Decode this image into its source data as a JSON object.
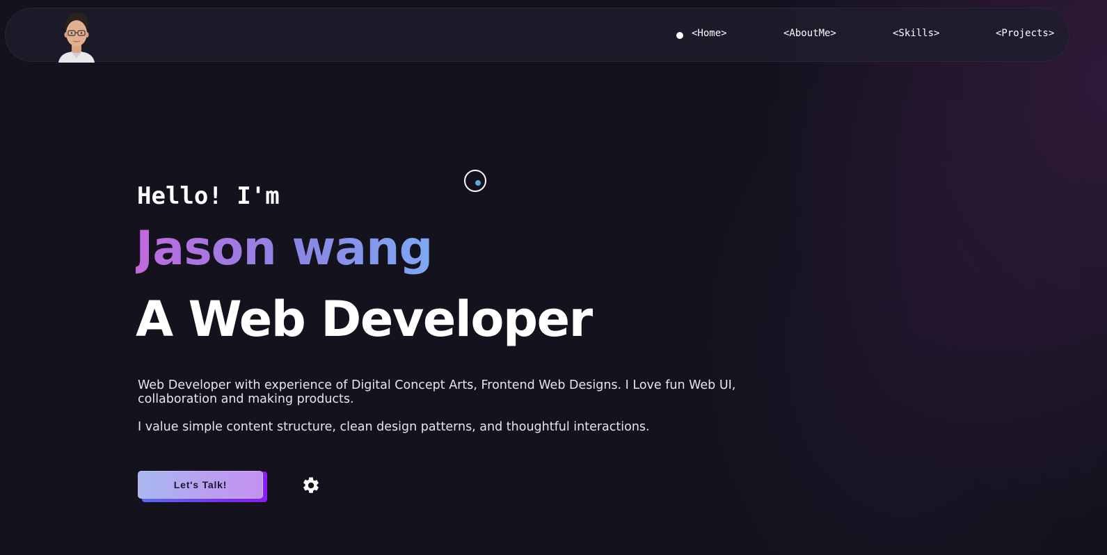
{
  "nav": {
    "items": [
      {
        "label": "<Home>",
        "active": true
      },
      {
        "label": "<AboutMe>",
        "active": false
      },
      {
        "label": "<Skills>",
        "active": false
      },
      {
        "label": "<Projects>",
        "active": false
      }
    ],
    "avatar_icon": "person-avatar"
  },
  "hero": {
    "greeting": "Hello! I'm",
    "name": "Jason wang",
    "role": "A Web Developer",
    "description_1": "Web Developer with experience of Digital Concept Arts, Frontend Web Designs. I Love fun Web UI, collaboration and making products.",
    "description_2": "I value simple content structure, clean design patterns, and thoughtful interactions."
  },
  "cta": {
    "label": "Let's Talk!"
  },
  "settings": {
    "icon": "gear-icon"
  },
  "colors": {
    "background": "#13121d",
    "name_gradient_start": "#c169de",
    "name_gradient_end": "#7ea8f2",
    "cta_gradient_start": "#a7b8f0",
    "cta_gradient_end": "#c292f1",
    "cursor_dot": "#5aa9e6"
  }
}
